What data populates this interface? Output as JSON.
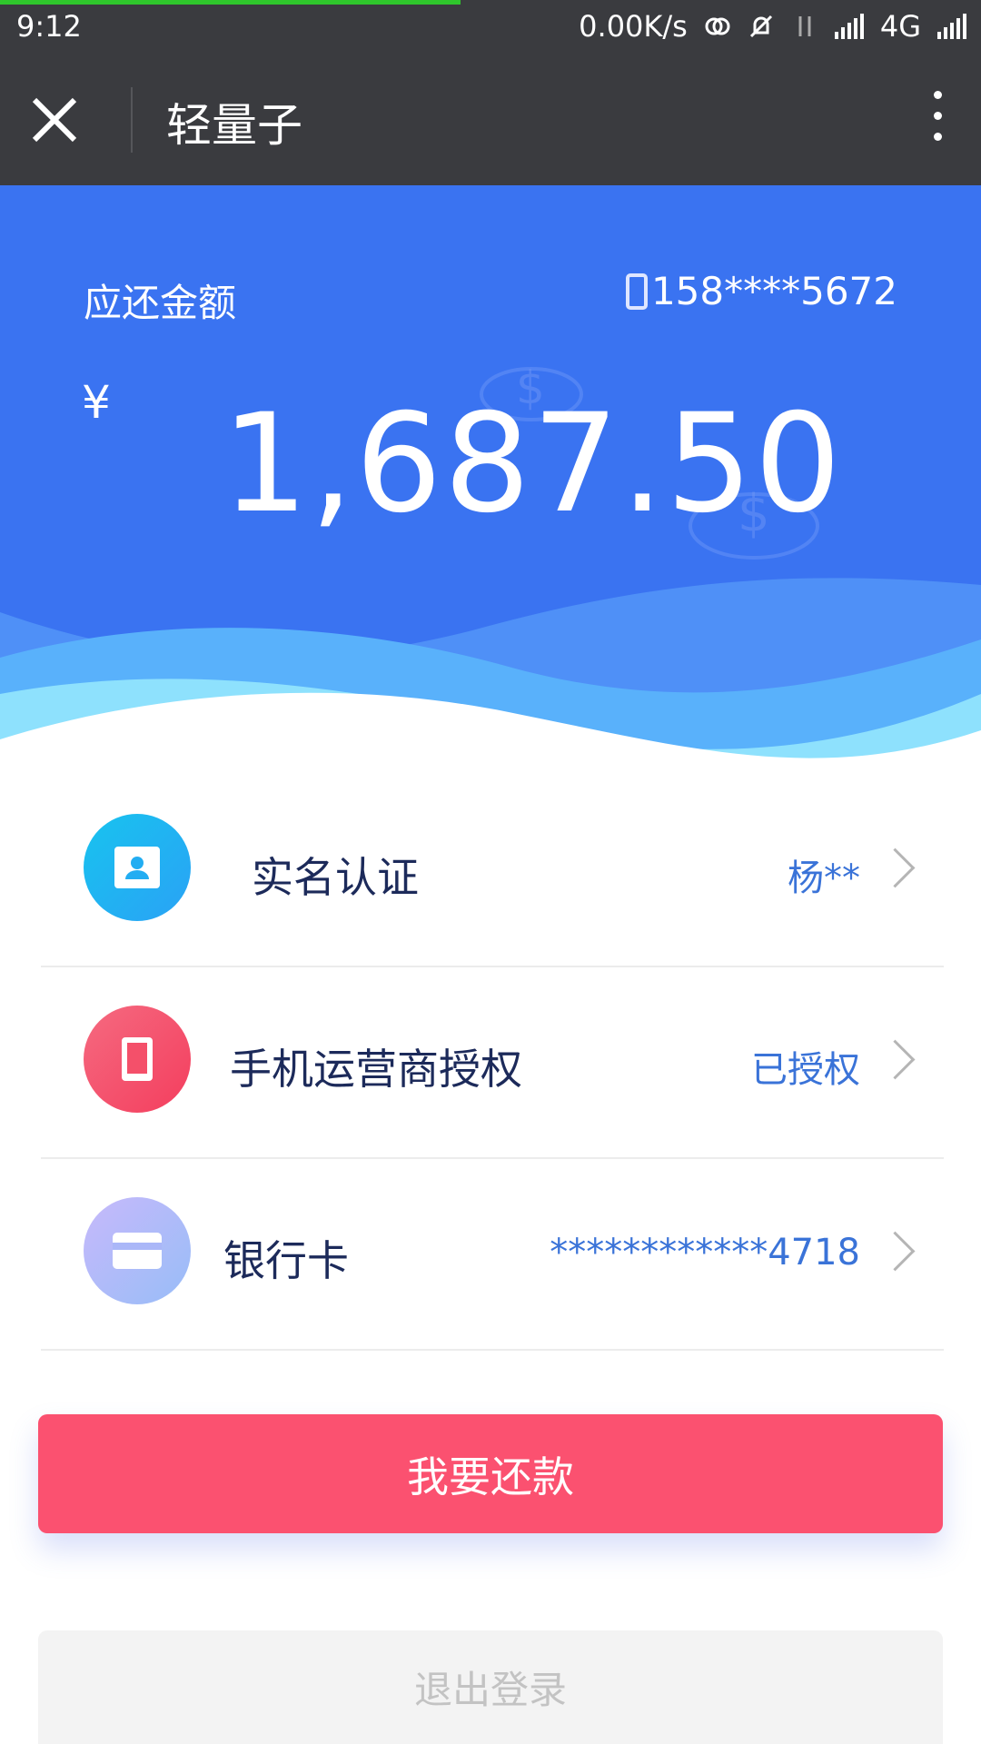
{
  "status_bar": {
    "time": "9:12",
    "net_speed": "0.00K/s",
    "network": "4G"
  },
  "title_bar": {
    "title": "轻量子",
    "close_icon": "close-icon",
    "menu_icon": "more-vert-icon"
  },
  "repayment": {
    "label": "应还金额",
    "phone": "158****5672",
    "currency": "¥",
    "amount": "1,687.50"
  },
  "items": [
    {
      "label": "实名认证",
      "value": "杨**",
      "icon": "id-card-icon",
      "color": "#1bb6ea"
    },
    {
      "label": "手机运营商授权",
      "value": "已授权",
      "icon": "mobile-phone-icon",
      "color": "#f74a67"
    },
    {
      "label": "银行卡",
      "value": "************4718",
      "icon": "bank-card-icon",
      "color": "#a9b6f9"
    }
  ],
  "buttons": {
    "repay": "我要还款",
    "logout": "退出登录"
  },
  "colors": {
    "primary": "#3a73f1",
    "accent": "#fb5170",
    "value_text": "#3a73d8"
  }
}
